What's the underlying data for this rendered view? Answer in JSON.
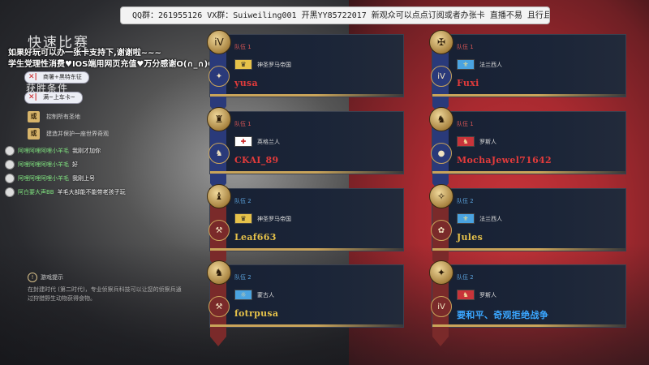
{
  "watermark": "QQ群：261955126 VX群：Suiweiling001 开黑YY85722017 新观众可以点点订阅或者办张卡 直播不易 且行且珍惜",
  "match_title": "快速比赛",
  "stream_overlay": {
    "line1": "如果好玩可以办一张卡支持下,谢谢啦~~~",
    "line2": "学生党理性消费♥IOS端用网页充值♥万分感谢O(∩_∩)O"
  },
  "mode_tags": [
    "商署+黑特东征",
    "满~上车卡~"
  ],
  "victory": {
    "label": "获胜条件",
    "conditions": [
      {
        "badge": "或",
        "text": "控制所有圣地"
      },
      {
        "badge": "或",
        "text": "建造并保护一座世界奇观"
      }
    ]
  },
  "chat": [
    {
      "name": "阿哩阿哩阿哩小羊毛",
      "message": "我刚才加你"
    },
    {
      "name": "阿哩阿哩阿哩小羊毛",
      "message": "好"
    },
    {
      "name": "阿哩阿哩阿哩小羊毛",
      "message": "我刚上号"
    },
    {
      "name": "阿白要大声BB",
      "message": "羊毛大部能不能带老孩子玩"
    }
  ],
  "hint": {
    "title": "游戏提示",
    "body": "在封建时代 (第二时代)，专业侦察兵科技可以让您的侦察兵通过狩猎野生动物获得食物。"
  },
  "teams": [
    {
      "team_label": "队伍 1",
      "civ": "神圣罗马帝国",
      "player": "yusa",
      "player_color": "#e23b3b",
      "flag": "hre",
      "medal": "iV",
      "emblem": "✦",
      "banner_color": "#2a3a7a"
    },
    {
      "team_label": "队伍 1",
      "civ": "法兰西人",
      "player": "Fuxi",
      "player_color": "#e23b3b",
      "flag": "fr",
      "medal": "✠",
      "emblem": "iV",
      "banner_color": "#2a3a7a"
    },
    {
      "team_label": "队伍 1",
      "civ": "英格兰人",
      "player": "CKAI_89",
      "player_color": "#e23b3b",
      "flag": "en",
      "medal": "♜",
      "emblem": "♞",
      "banner_color": "#2a3a7a"
    },
    {
      "team_label": "队伍 1",
      "civ": "罗斯人",
      "player": "MochaJewel71642",
      "player_color": "#e23b3b",
      "flag": "rus",
      "medal": "♞",
      "emblem": "●",
      "banner_color": "#2a3a7a"
    },
    {
      "team_label": "队伍 2",
      "civ": "神圣罗马帝国",
      "player": "Leaf663",
      "player_color": "#e6c24a",
      "flag": "hre",
      "medal": "♝",
      "emblem": "⚒",
      "banner_color": "#7a2a2a"
    },
    {
      "team_label": "队伍 2",
      "civ": "法兰西人",
      "player": "Jules",
      "player_color": "#e6c24a",
      "flag": "fr",
      "medal": "✧",
      "emblem": "✿",
      "banner_color": "#7a2a2a"
    },
    {
      "team_label": "队伍 2",
      "civ": "蒙古人",
      "player": "fotrpusa",
      "player_color": "#e6c24a",
      "flag": "mon",
      "medal": "♞",
      "emblem": "⚒",
      "banner_color": "#7a2a2a"
    },
    {
      "team_label": "队伍 2",
      "civ": "罗斯人",
      "player": "要和平、奇观拒绝战争",
      "player_color": "#3aa6ff",
      "flag": "rus",
      "medal": "✦",
      "emblem": "iV",
      "banner_color": "#7a2a2a"
    }
  ]
}
